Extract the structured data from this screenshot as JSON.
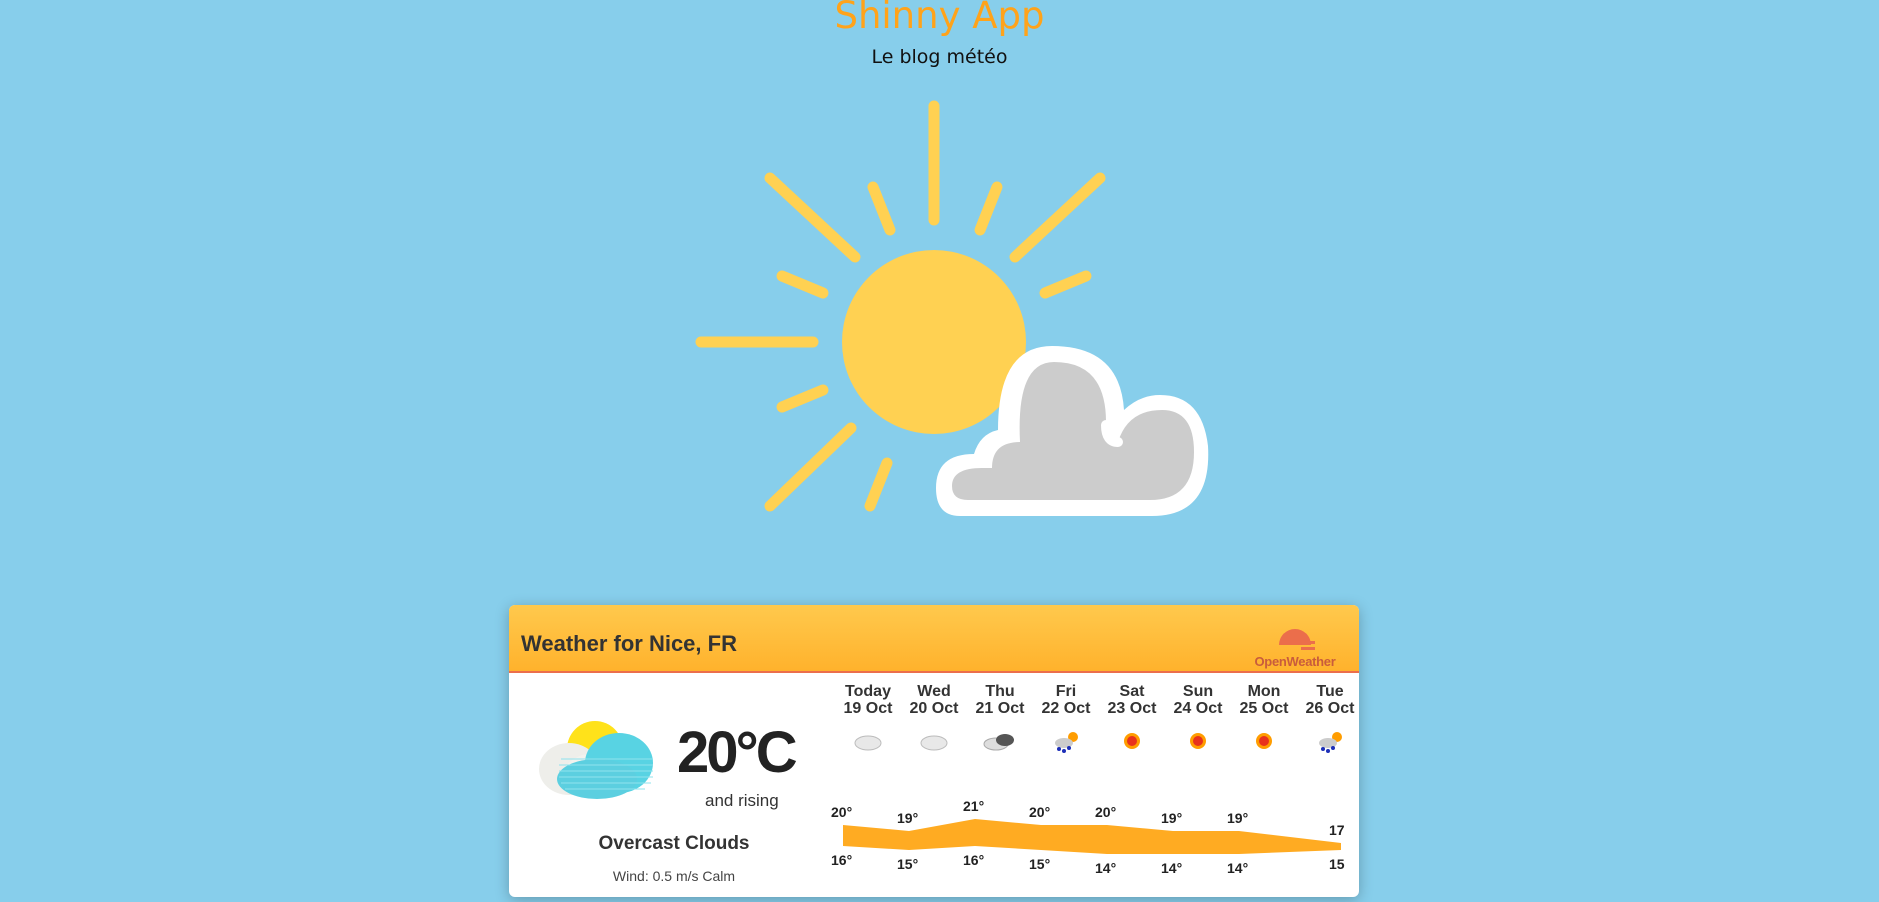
{
  "header": {
    "title": "Shinny App",
    "subtitle": "Le blog météo"
  },
  "hero_icon": "sun-behind-cloud-icon",
  "widget": {
    "title": "Weather for Nice, FR",
    "provider": "OpenWeather",
    "current": {
      "temperature": "20°C",
      "trend": "and rising",
      "condition": "Overcast Clouds",
      "wind": "Wind: 0.5 m/s Calm",
      "icon": "overcast-clouds-icon"
    },
    "forecast": [
      {
        "day": "Today",
        "date": "19 Oct",
        "high": "20°",
        "low": "16°",
        "high_value": 20,
        "low_value": 16,
        "icon": "cloud-icon"
      },
      {
        "day": "Wed",
        "date": "20 Oct",
        "high": "19°",
        "low": "15°",
        "high_value": 19,
        "low_value": 15,
        "icon": "cloud-icon"
      },
      {
        "day": "Thu",
        "date": "21 Oct",
        "high": "21°",
        "low": "16°",
        "high_value": 21,
        "low_value": 16,
        "icon": "dark-cloud-icon"
      },
      {
        "day": "Fri",
        "date": "22 Oct",
        "high": "20°",
        "low": "15°",
        "high_value": 20,
        "low_value": 15,
        "icon": "sun-rain-icon"
      },
      {
        "day": "Sat",
        "date": "23 Oct",
        "high": "20°",
        "low": "14°",
        "high_value": 20,
        "low_value": 14,
        "icon": "sun-icon"
      },
      {
        "day": "Sun",
        "date": "24 Oct",
        "high": "19°",
        "low": "14°",
        "high_value": 19,
        "low_value": 14,
        "icon": "sun-icon"
      },
      {
        "day": "Mon",
        "date": "25 Oct",
        "high": "19°",
        "low": "14°",
        "high_value": 19,
        "low_value": 14,
        "icon": "sun-icon"
      },
      {
        "day": "Tue",
        "date": "26 Oct",
        "high": "17",
        "low": "15",
        "high_value": 17,
        "low_value": 15,
        "icon": "sun-rain-icon"
      }
    ]
  },
  "colors": {
    "background": "#87ceeb",
    "title": "#ffa31a",
    "sun": "#ffd152",
    "cloud": "#cccccc",
    "header_gradient_top": "#ffc94d",
    "header_gradient_bottom": "#ffb22c",
    "temp_band": "#ffab22"
  }
}
